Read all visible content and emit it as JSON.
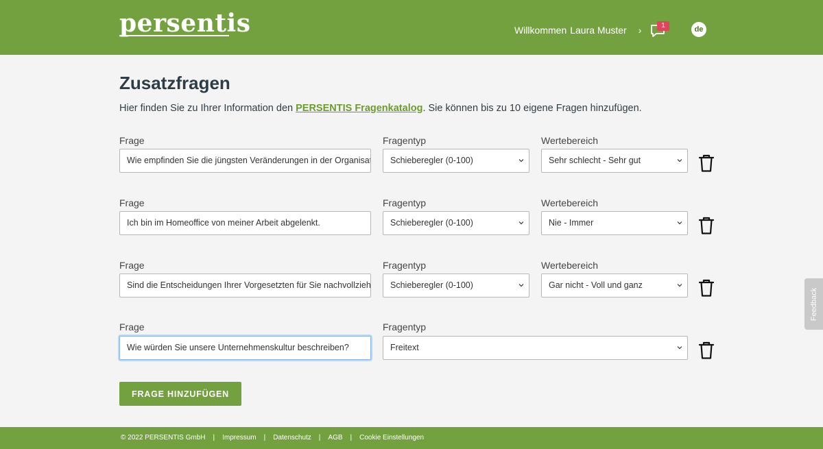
{
  "header": {
    "logo": "persentis",
    "welcome_label": "Willkommen",
    "user_name": "Laura Muster",
    "message_count": "1",
    "language": "de",
    "brand_color": "#73a13f"
  },
  "page": {
    "title": "Zusatzfragen",
    "intro_before": "Hier finden Sie zu Ihrer Information den ",
    "intro_link": "PERSENTIS Fragenkatalog",
    "intro_after": ". Sie können bis zu 10 eigene Fragen hinzufügen."
  },
  "labels": {
    "question": "Frage",
    "type": "Fragentyp",
    "range": "Wertebereich"
  },
  "questions": [
    {
      "text": "Wie empfinden Sie die jüngsten Veränderungen in der Organisation?",
      "type": "Schieberegler (0-100)",
      "range": "Sehr schlecht - Sehr gut"
    },
    {
      "text": "Ich bin im Homeoffice von meiner Arbeit abgelenkt.",
      "type": "Schieberegler (0-100)",
      "range": "Nie - Immer"
    },
    {
      "text": "Sind die Entscheidungen Ihrer Vorgesetzten für Sie nachvollziehbar?",
      "type": "Schieberegler (0-100)",
      "range": "Gar nicht - Voll und ganz"
    },
    {
      "text": "Wie würden Sie unsere Unternehmenskultur beschreiben?",
      "type": "Freitext"
    }
  ],
  "add_button": "FRAGE HINZUFÜGEN",
  "footer": {
    "copyright": "© 2022 PERSENTIS GmbH",
    "separator": "|",
    "links": [
      "Impressum",
      "Datenschutz",
      "AGB",
      "Cookie Einstellungen"
    ]
  },
  "feedback": "Feedback"
}
